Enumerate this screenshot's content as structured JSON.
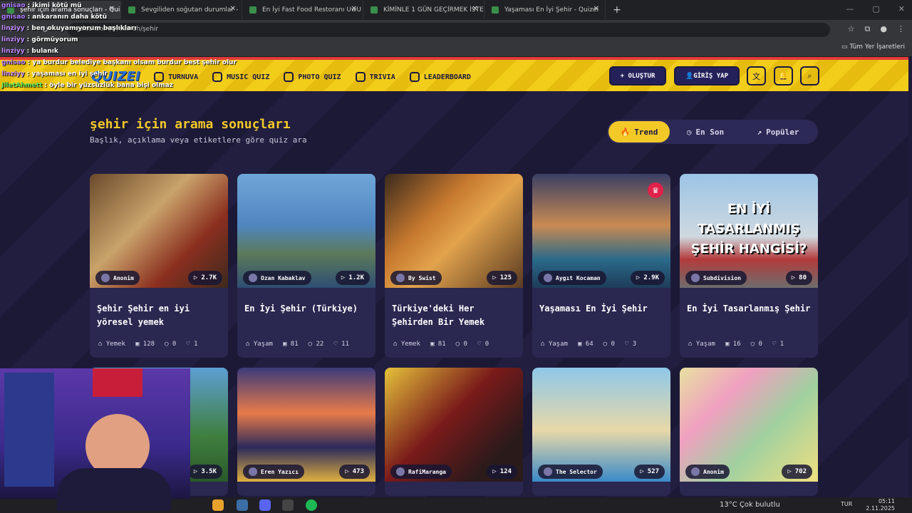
{
  "browser": {
    "tabs": [
      {
        "title": "şehir için arama sonuçları - Quizei",
        "active": true
      },
      {
        "title": "Sevgiliden soğutan durumlar -",
        "active": false
      },
      {
        "title": "En İyi Fast Food Restoranı UwU",
        "active": false
      },
      {
        "title": "KİMİNLE 1 GÜN GEÇİRMEK İSTE",
        "active": false
      },
      {
        "title": "Yaşaması En İyi Şehir - Quizei",
        "active": false
      }
    ],
    "url": "quizei.com/tr/search/şehir",
    "bookmarks_label": "Tüm Yer İşaretleri"
  },
  "chat": [
    {
      "user": "gnisao",
      "msg": "ikimi kötü mü",
      "color": "#b07cff"
    },
    {
      "user": "gnisao",
      "msg": "ankaranın daha kötü",
      "color": "#b07cff"
    },
    {
      "user": "linziyy",
      "msg": "ben okuyamıyorum başlıkları",
      "color": "#c38cff"
    },
    {
      "user": "linziyy",
      "msg": "görmüyorum",
      "color": "#c38cff"
    },
    {
      "user": "linziyy",
      "msg": "bulanık",
      "color": "#c38cff"
    },
    {
      "user": "gnisao",
      "msg": "ya burdur belediye başkanı olsam burdur best şehir olur",
      "color": "#b07cff"
    },
    {
      "user": "linziyy",
      "msg": "yaşaması en iyi şehir",
      "color": "#c38cff"
    },
    {
      "user": "JiletAhmett",
      "msg": "öyle bir yüzsüzlük bana bişi olmaz",
      "color": "#5ee85e"
    }
  ],
  "nav": {
    "logo": "QUIZEI",
    "links": [
      "TURNUVA",
      "MUSIC QUIZ",
      "PHOTO QUIZ",
      "TRIVIA",
      "LEADERBOARD"
    ],
    "create": "+ OLUŞTUR",
    "login": "GİRİŞ YAP"
  },
  "page": {
    "title": "şehir için arama sonuçları",
    "subtitle": "Başlık, açıklama veya etiketlere göre quiz ara",
    "sort": [
      "Trend",
      "En Son",
      "Popüler"
    ]
  },
  "cards": [
    {
      "author": "Anonim",
      "plays": "2.7K",
      "title": "Şehir Şehir en iyi yöresel yemek",
      "cat": "Yemek",
      "q": "128",
      "c": "0",
      "l": "1",
      "bg": "linear-gradient(135deg,#6b4a2b,#c9a36a 40%,#8b2f1f 70%,#3c2a1d)"
    },
    {
      "author": "Ozan Kabaklav",
      "plays": "1.2K",
      "title": "En İyi Şehir (Türkiye)",
      "cat": "Yaşam",
      "q": "81",
      "c": "22",
      "l": "11",
      "bg": "linear-gradient(180deg,#6fa6d8 0%,#4f86c0 45%,#5c7a5a 70%,#2e4e73 100%)"
    },
    {
      "author": "By Swist",
      "plays": "125",
      "title": "Türkiye'deki Her Şehirden Bir Yemek",
      "cat": "Yemek",
      "q": "81",
      "c": "0",
      "l": "0",
      "bg": "linear-gradient(135deg,#3a2a1e,#c6782e 35%,#e2a34c 55%,#5a3a22)"
    },
    {
      "author": "Aygıt Kocaman",
      "plays": "2.9K",
      "title": "Yaşaması En İyi Şehir",
      "cat": "Yaşam",
      "q": "64",
      "c": "0",
      "l": "3",
      "bg": "linear-gradient(180deg,#3a3f66 0%,#c98a52 45%,#2b6a8a 75%,#1e3c5a 100%)",
      "crown": true
    },
    {
      "author": "Subdivision",
      "plays": "80",
      "title": "En İyi Tasarlanmış Şehir",
      "cat": "Yaşam",
      "q": "16",
      "c": "0",
      "l": "1",
      "bg": "linear-gradient(180deg,#9cc3e6 0%,#cfd9e0 55%,#b33b3b 75%,#6d6d6d 100%)",
      "overlay": [
        "EN İYİ",
        "TASARLANMIŞ",
        "ŞEHİR HANGİSİ?"
      ]
    }
  ],
  "cards2": [
    {
      "author": "",
      "plays": "3.5K",
      "bg": "linear-gradient(180deg,#5d9fd4,#3f7f3f 60%,#2a5a2a)"
    },
    {
      "author": "Eren Yazıcı",
      "plays": "473",
      "bg": "linear-gradient(180deg,#3b3a7a 0%,#e87a4a 40%,#2b2a5a 70%,#e0b040 100%)"
    },
    {
      "author": "RafiMaranga",
      "plays": "124",
      "bg": "linear-gradient(135deg,#e6c23a,#7a1a1a 45%,#2a1a1a 80%)"
    },
    {
      "author": "The Selector",
      "plays": "527",
      "bg": "linear-gradient(180deg,#8ec7e8 0%,#e8d8a8 55%,#3a8ac8 100%)"
    },
    {
      "author": "Anonim",
      "plays": "702",
      "bg": "linear-gradient(135deg,#e8e0a0,#f0a0c0 30%,#a0d0a0 60%,#f0e080)"
    }
  ],
  "taskbar": {
    "weather": "13°C  Çok bulutlu",
    "lang": "TUR",
    "time": "05:11",
    "date": "2.11.2025"
  }
}
